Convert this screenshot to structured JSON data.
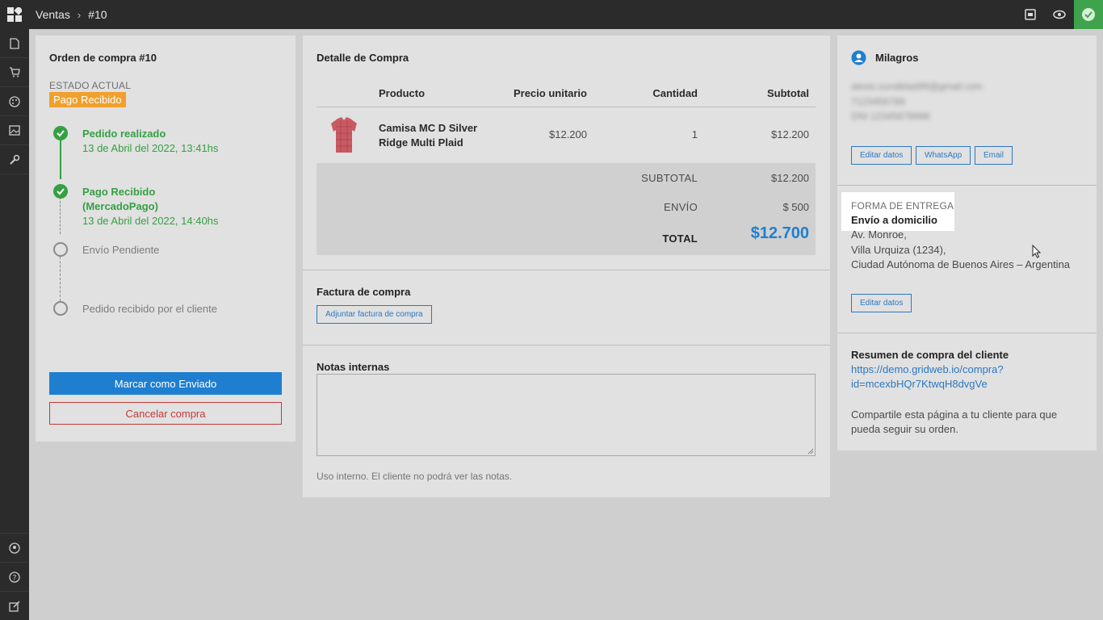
{
  "breadcrumb": {
    "section": "Ventas",
    "current": "#10"
  },
  "colors": {
    "accent": "#1e7fd0",
    "success": "#35a043",
    "warning": "#f0a02c",
    "danger": "#c43a36",
    "topbar": "#2b2b2b"
  },
  "topbar_icons": [
    "archive-icon",
    "eye-icon",
    "check-circle-icon"
  ],
  "sidebar_icons": [
    "document-icon",
    "cart-icon",
    "palette-icon",
    "image-icon",
    "tools-icon"
  ],
  "sidebar_bottom_icons": [
    "user-circle-icon",
    "help-icon",
    "external-edit-icon"
  ],
  "order": {
    "title": "Orden de compra #10",
    "status_label": "ESTADO ACTUAL",
    "status_value": "Pago Recibido",
    "steps": [
      {
        "title": "Pedido realizado",
        "date": "13 de Abril del 2022, 13:41hs",
        "done": true
      },
      {
        "title": "Pago Recibido (MercadoPago)",
        "date": "13 de Abril del 2022, 14:40hs",
        "done": true
      },
      {
        "title": "Envío Pendiente",
        "done": false
      },
      {
        "title": "Pedido recibido por el cliente",
        "done": false
      }
    ],
    "primary_button": "Marcar como Enviado",
    "cancel_button": "Cancelar compra"
  },
  "detail": {
    "title": "Detalle de Compra",
    "columns": {
      "product": "Producto",
      "unit_price": "Precio unitario",
      "qty": "Cantidad",
      "subtotal": "Subtotal"
    },
    "item": {
      "name": "Camisa MC D Silver Ridge Multi Plaid",
      "unit_price": "$12.200",
      "qty": "1",
      "subtotal": "$12.200"
    },
    "totals": {
      "subtotal_label": "SUBTOTAL",
      "subtotal_value": "$12.200",
      "shipping_label": "ENVÍO",
      "shipping_value": "$ 500",
      "total_label": "TOTAL",
      "total_value": "$12.700"
    },
    "invoice_title": "Factura de compra",
    "invoice_button": "Adjuntar factura de compra",
    "notes_title": "Notas internas",
    "notes_value": "",
    "notes_hint": "Uso interno. El cliente no podrá ver las notas."
  },
  "customer": {
    "name": "Milagros",
    "email": "alexis.sundblad99@gmail.com",
    "phone": "7123456789",
    "dni": "DNI 12345678998",
    "edit_button": "Editar datos",
    "whatsapp_button": "WhatsApp",
    "email_button": "Email",
    "delivery_label": "FORMA DE ENTREGA",
    "delivery_value": "Envío a domicilio",
    "address_line1": "Av. Monroe,",
    "address_line2": "Villa Urquiza (1234),",
    "address_line3": "Ciudad Autónoma de Buenos Aires – Argentina",
    "address_edit_button": "Editar datos",
    "summary_title": "Resumen de compra del cliente",
    "summary_link_line1": "https://demo.gridweb.io/compra?",
    "summary_link_line2": "id=mcexbHQr7KtwqH8dvgVe",
    "share_text": "Compartile esta página a tu cliente para que pueda seguir su orden."
  }
}
